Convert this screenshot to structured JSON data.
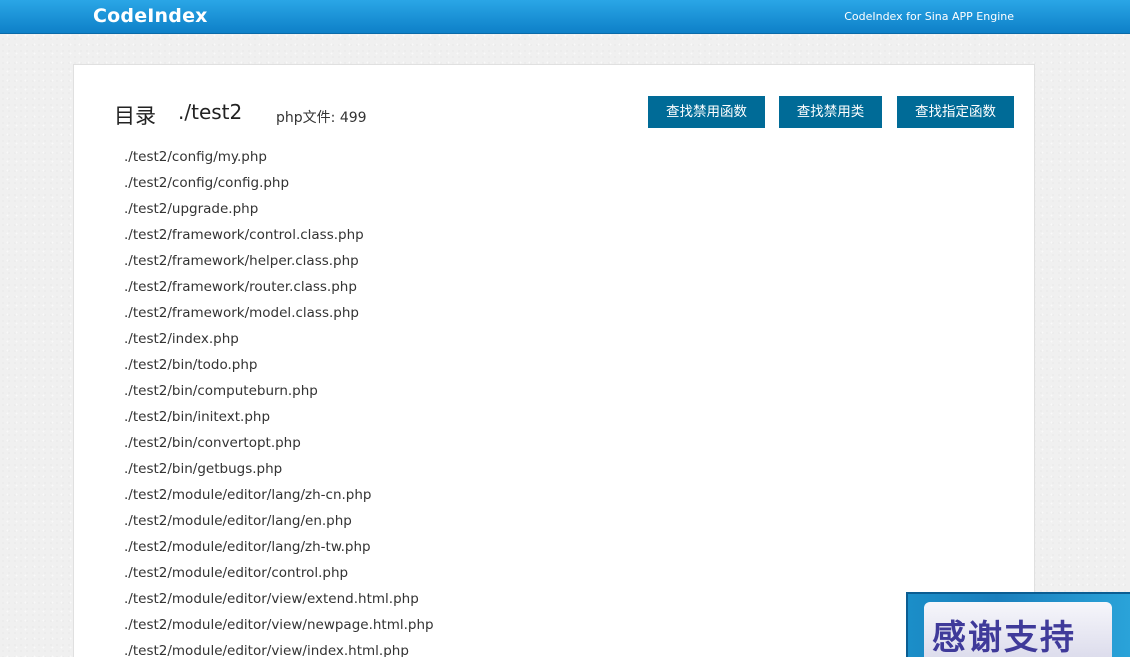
{
  "header": {
    "brand": "CodeIndex",
    "tagline": "CodeIndex for Sina APP Engine"
  },
  "main": {
    "title_label": "目录",
    "title_path": "./test2",
    "file_count_label": "php文件: 499",
    "buttons": {
      "find_banned_functions": "查找禁用函数",
      "find_banned_classes": "查找禁用类",
      "find_specified_functions": "查找指定函数"
    },
    "files": [
      "./test2/config/my.php",
      "./test2/config/config.php",
      "./test2/upgrade.php",
      "./test2/framework/control.class.php",
      "./test2/framework/helper.class.php",
      "./test2/framework/router.class.php",
      "./test2/framework/model.class.php",
      "./test2/index.php",
      "./test2/bin/todo.php",
      "./test2/bin/computeburn.php",
      "./test2/bin/initext.php",
      "./test2/bin/convertopt.php",
      "./test2/bin/getbugs.php",
      "./test2/module/editor/lang/zh-cn.php",
      "./test2/module/editor/lang/en.php",
      "./test2/module/editor/lang/zh-tw.php",
      "./test2/module/editor/control.php",
      "./test2/module/editor/view/extend.html.php",
      "./test2/module/editor/view/newpage.html.php",
      "./test2/module/editor/view/index.html.php"
    ]
  },
  "support_widget": {
    "label": "感谢支持"
  },
  "colors": {
    "header_blue": "#1793d6",
    "button_blue": "#006b97",
    "support_text": "#3f3a9a"
  }
}
